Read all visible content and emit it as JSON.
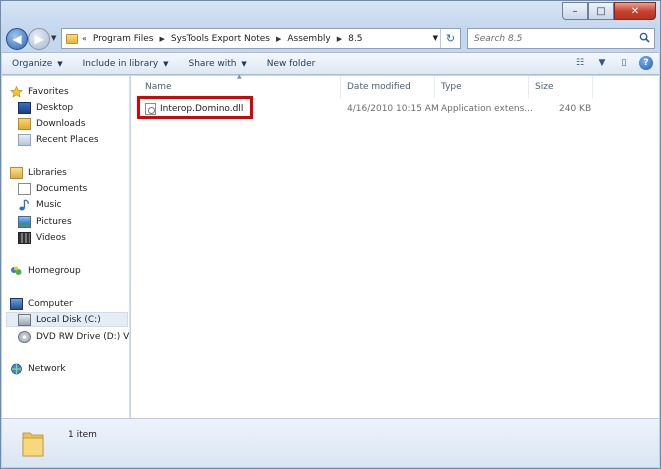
{
  "window": {
    "minimize": "–",
    "maximize": "□",
    "close": "✕"
  },
  "nav": {
    "back": "◀",
    "forward": "▶",
    "dropdown": "▼"
  },
  "address": {
    "overflow": "«",
    "crumbs": [
      "Program Files",
      "SysTools Export Notes",
      "Assembly",
      "8.5"
    ],
    "separator": "▶",
    "dropdown": "▼",
    "refresh": "↻"
  },
  "search": {
    "placeholder": "Search 8.5"
  },
  "toolbar": {
    "organize": "Organize",
    "include_in_library": "Include in library",
    "share_with": "Share with",
    "new_folder": "New folder",
    "caret": "▼",
    "views": "☷",
    "views_caret": "▼",
    "preview_pane": "▯",
    "help": "?"
  },
  "sidebar": {
    "favorites": "Favorites",
    "desktop": "Desktop",
    "downloads": "Downloads",
    "recent_places": "Recent Places",
    "libraries": "Libraries",
    "documents": "Documents",
    "music": "Music",
    "pictures": "Pictures",
    "videos": "Videos",
    "homegroup": "Homegroup",
    "computer": "Computer",
    "local_disk": "Local Disk (C:)",
    "dvd_drive": "DVD RW Drive (D:) V",
    "network": "Network"
  },
  "columns": {
    "name": "Name",
    "date_modified": "Date modified",
    "type": "Type",
    "size": "Size",
    "sort_indicator": "▲"
  },
  "files": [
    {
      "name": "Interop.Domino.dll",
      "date_modified": "4/16/2010 10:15 AM",
      "type": "Application extens...",
      "size": "240 KB"
    }
  ],
  "status": {
    "item_count": "1 item"
  },
  "colors": {
    "highlight": "#e00000",
    "accent": "#1d5db5"
  }
}
